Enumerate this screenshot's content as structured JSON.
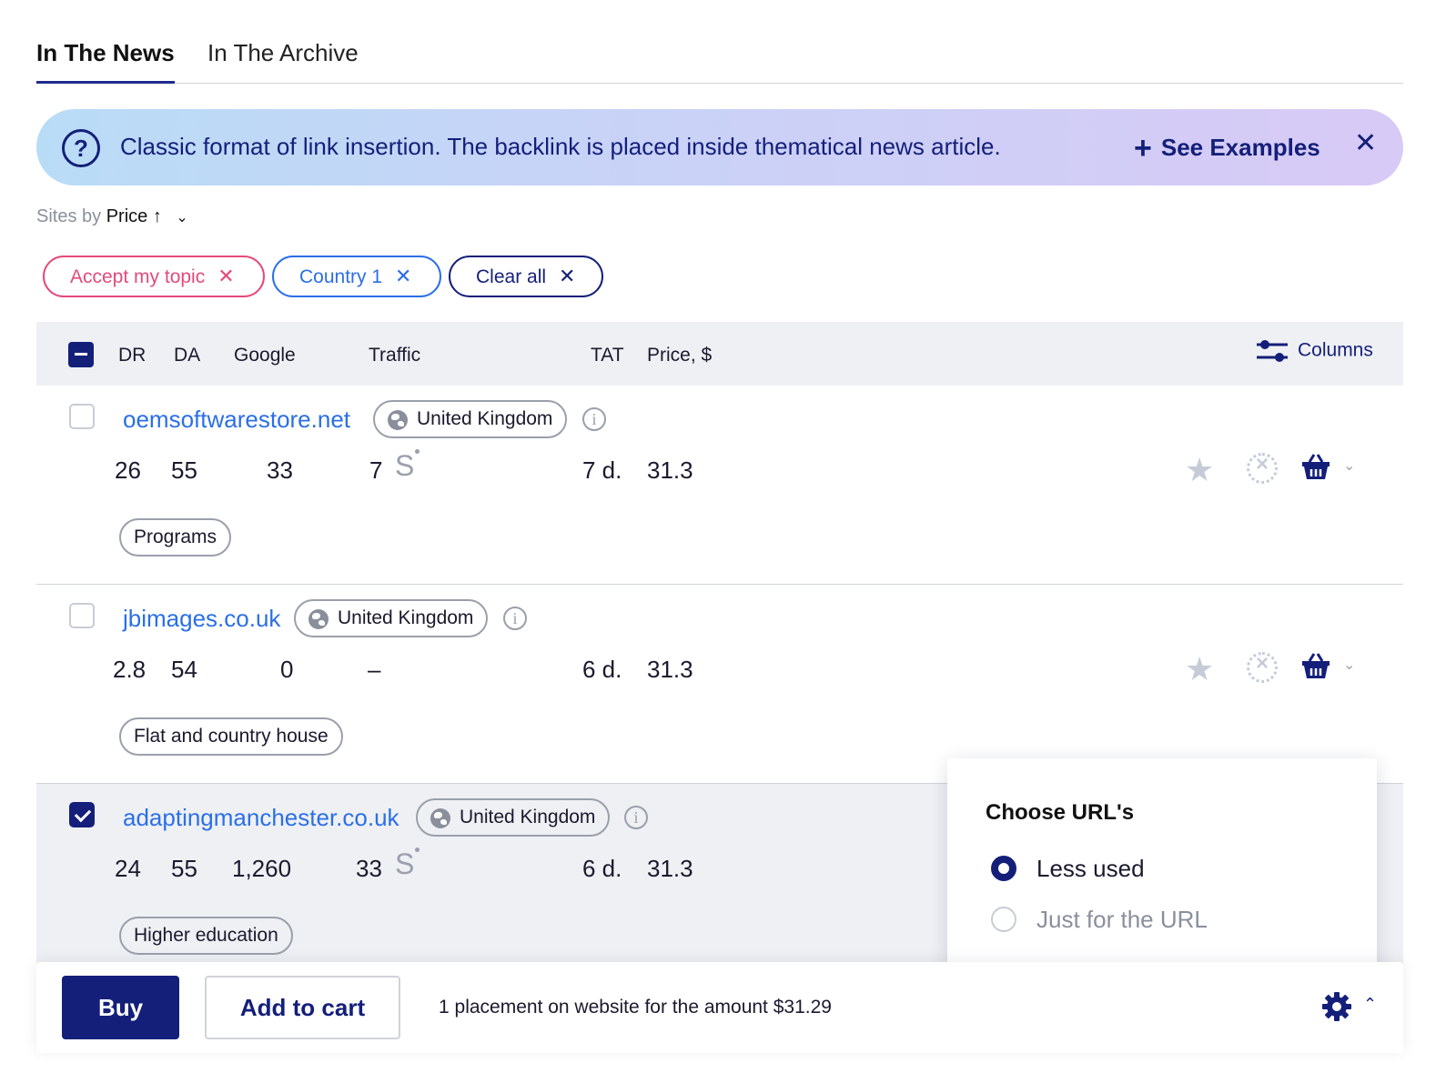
{
  "tabs": [
    {
      "label": "In The News",
      "active": true
    },
    {
      "label": "In The Archive",
      "active": false
    }
  ],
  "banner": {
    "icon": "question-circle-icon",
    "message": "Classic format of link insertion. The backlink is placed inside thematical news article.",
    "see_examples_label": "See Examples",
    "close_icon": "close-icon"
  },
  "sort": {
    "prefix": "Sites by",
    "value": "Price",
    "direction_icon": "↑",
    "chevron": "⌄"
  },
  "filters": [
    {
      "label": "Accept my topic",
      "color": "#e34a7a"
    },
    {
      "label": "Country 1",
      "color": "#2b6fe6"
    },
    {
      "label": "Clear all",
      "color": "#141f7a"
    }
  ],
  "table": {
    "headers": {
      "dr": "DR",
      "da": "DA",
      "google": "Google",
      "traffic": "Traffic",
      "tat": "TAT",
      "price": "Price, $"
    },
    "columns_button": "Columns",
    "rows": [
      {
        "domain": "oemsoftwarestore.net",
        "country": "United Kingdom",
        "dr": "26",
        "da": "55",
        "google": "33",
        "traffic": "7",
        "traffic_icon": "S",
        "tat": "7 d.",
        "price": "31.3",
        "topic": "Programs",
        "checked": false
      },
      {
        "domain": "jbimages.co.uk",
        "country": "United Kingdom",
        "dr": "2.8",
        "da": "54",
        "google": "0",
        "traffic": "–",
        "traffic_icon": "",
        "tat": "6 d.",
        "price": "31.3",
        "topic": "Flat and country house",
        "checked": false
      },
      {
        "domain": "adaptingmanchester.co.uk",
        "country": "United Kingdom",
        "dr": "24",
        "da": "55",
        "google": "1,260",
        "traffic": "33",
        "traffic_icon": "S",
        "tat": "6 d.",
        "price": "31.3",
        "topic": "Higher education",
        "checked": true
      }
    ]
  },
  "url_popover": {
    "title": "Choose URL's",
    "options": [
      {
        "label": "Less used",
        "selected": true
      },
      {
        "label": "Just for the URL",
        "selected": false
      }
    ]
  },
  "bottom_bar": {
    "buy_label": "Buy",
    "add_to_cart_label": "Add to cart",
    "summary": "1 placement on website for the amount $31.29"
  },
  "colors": {
    "accent": "#141f7a",
    "link": "#2b6fe6",
    "topic_chip": "#e34a7a",
    "row_selected": "#eef0f4"
  }
}
